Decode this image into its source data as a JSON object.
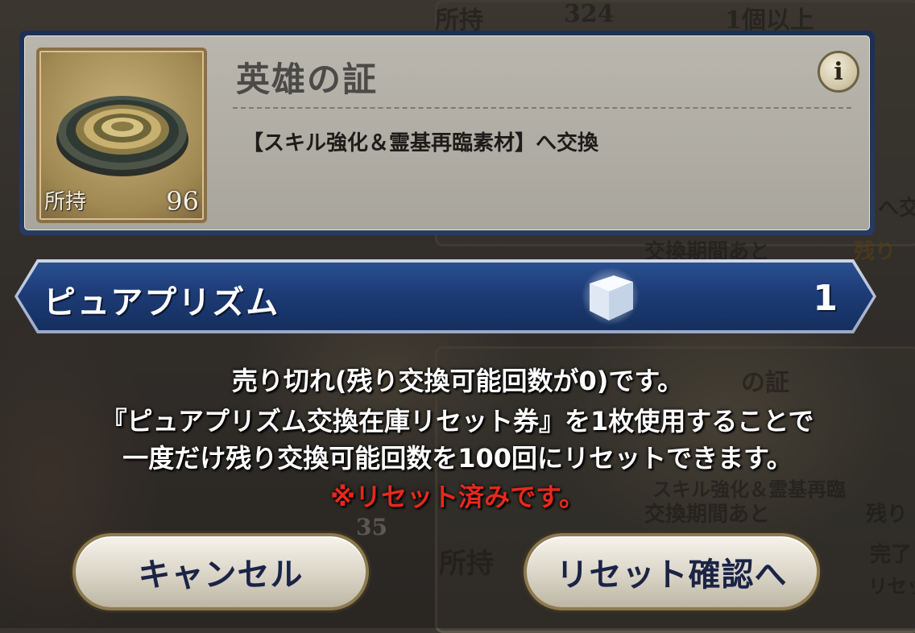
{
  "item": {
    "name": "英雄の証",
    "owned_label": "所持",
    "owned_count": "96",
    "description": "【スキル強化＆霊基再臨素材】へ交換",
    "info_icon": "i"
  },
  "exchange": {
    "currency_name": "ピュアプリズム",
    "cost": "1"
  },
  "message": {
    "line1": "売り切れ(残り交換可能回数が0)です。",
    "line2": "『ピュアプリズム交換在庫リセット券』を1枚使用することで",
    "line3": "一度だけ残り交換可能回数を100回にリセットできます。",
    "warning": "※リセット済みです。"
  },
  "buttons": {
    "cancel": "キャンセル",
    "confirm": "リセット確認へ"
  },
  "background": {
    "texts": [
      "所持",
      "324",
      "1個以上",
      "交換期間あと",
      "残り",
      "へ交",
      "の証",
      "スキル強化＆霊基再臨",
      "交換期間あと",
      "残り",
      "所持",
      "完了",
      "リセッ",
      "35"
    ]
  },
  "colors": {
    "bar_blue": "#1c3a74",
    "warning_red": "#e8281e",
    "button_text": "#1b2346"
  }
}
